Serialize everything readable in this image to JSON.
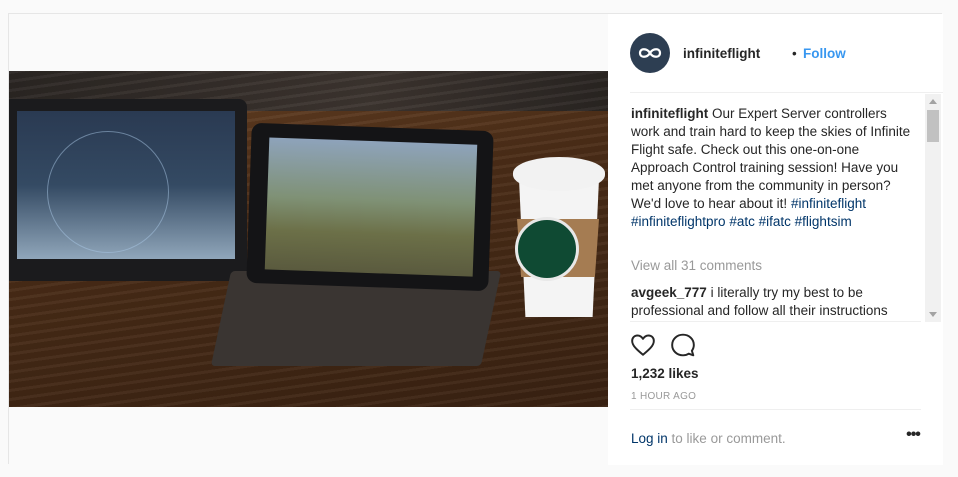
{
  "post": {
    "username": "infiniteflight",
    "separator": "•",
    "follow_label": "Follow",
    "caption_user": "infiniteflight",
    "caption_text": "Our Expert Server controllers work and train hard to keep the skies of Infinite Flight safe. Check out this one-on-one Approach Control training session! Have you met anyone from the community in person? We'd love to hear about it! ",
    "hashtags": [
      "#infiniteflight",
      "#infiniteflightpro",
      "#atc",
      "#ifatc",
      "#flightsim"
    ],
    "view_all_comments": "View all 31 comments",
    "comments": [
      {
        "user": "avgeek_777",
        "text": "i literally try my best to be professional and follow all their instructions"
      }
    ],
    "likes": "1,232 likes",
    "time": "1 HOUR AGO",
    "login_link": "Log in",
    "login_suffix": " to like or comment.",
    "more_label": "•••"
  },
  "icons": {
    "avatar": "infinity-logo-icon",
    "like": "heart-icon",
    "comment": "comment-bubble-icon",
    "more": "ellipsis-icon"
  },
  "colors": {
    "link_blue": "#3897f0",
    "hashtag": "#003569",
    "muted": "#999999",
    "avatar_bg": "#2d3e52"
  }
}
